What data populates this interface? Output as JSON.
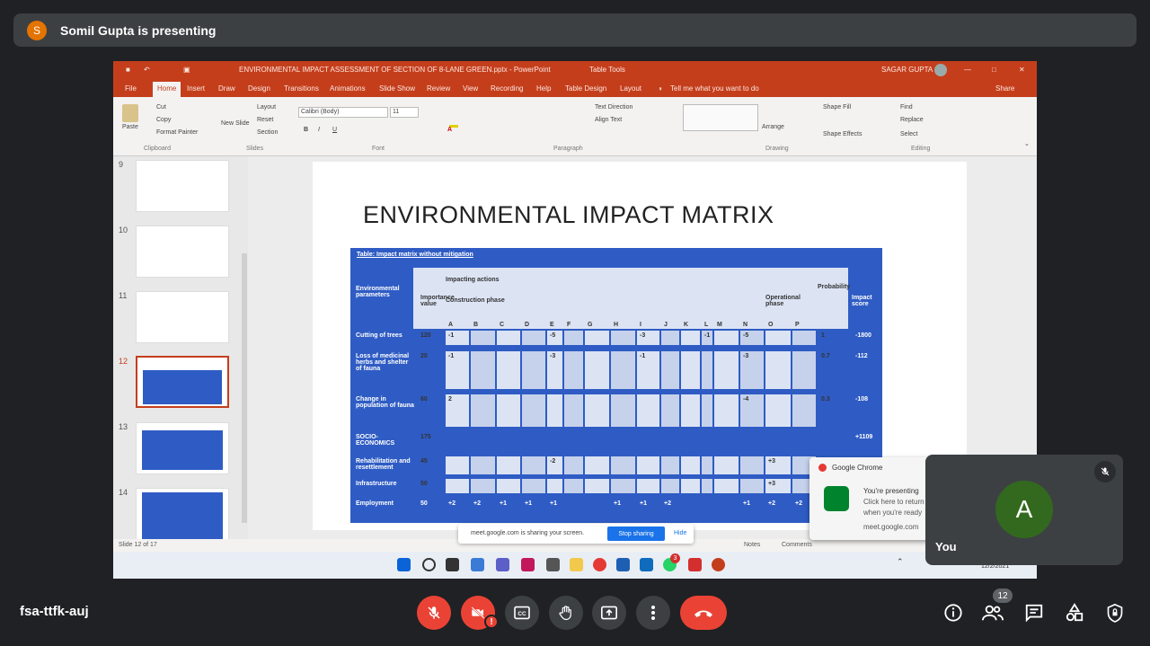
{
  "meet": {
    "presenter_initial": "S",
    "presenting_text": "Somil Gupta is presenting",
    "meeting_code": "fsa-ttfk-auj",
    "participant_count": "12",
    "self_initial": "A",
    "self_label": "You"
  },
  "ppt": {
    "title": "ENVIRONMENTAL IMPACT ASSESSMENT OF SECTION OF 8-LANE GREEN.pptx - PowerPoint",
    "table_tools": "Table Tools",
    "user": "SAGAR GUPTA",
    "tabs": [
      "File",
      "Home",
      "Insert",
      "Draw",
      "Design",
      "Transitions",
      "Animations",
      "Slide Show",
      "Review",
      "View",
      "Recording",
      "Help",
      "Table Design",
      "Layout"
    ],
    "tell_me": "Tell me what you want to do",
    "share": "Share",
    "ribbon": {
      "paste": "Paste",
      "cut": "Cut",
      "copy": "Copy",
      "format_painter": "Format Painter",
      "new_slide": "New Slide",
      "layout": "Layout",
      "reset": "Reset",
      "section": "Section",
      "font_name": "Calibri (Body)",
      "font_size": "11",
      "text_direction": "Text Direction",
      "align_text": "Align Text",
      "arrange": "Arrange",
      "shape_fill": "Shape Fill",
      "shape_effects": "Shape Effects",
      "find": "Find",
      "replace": "Replace",
      "select": "Select",
      "groups": [
        "Clipboard",
        "Slides",
        "Font",
        "Paragraph",
        "Drawing",
        "Editing"
      ]
    },
    "thumb_numbers": [
      "9",
      "10",
      "11",
      "12",
      "13",
      "14"
    ],
    "slide_title": "ENVIRONMENTAL IMPACT MATRIX",
    "status": "Slide 12 of 17",
    "notes": "Notes",
    "comments": "Comments",
    "clock_date": "12/2/2021",
    "taskbar_badge": "3"
  },
  "table": {
    "caption": "Table: Impact matrix without mitigation",
    "h_env": "Environmental parameters",
    "h_importance": "Importance value",
    "h_impacting": "Impacting actions",
    "h_construction": "Construction phase",
    "h_operational": "Operational phase",
    "h_prob": "Probability",
    "h_impact": "Impact score",
    "letters": [
      "A",
      "B",
      "C",
      "D",
      "E",
      "F",
      "G",
      "H",
      "I",
      "J",
      "K",
      "L",
      "M",
      "N",
      "O",
      "P"
    ],
    "rows": [
      {
        "name": "Cutting of trees",
        "imp": "120",
        "vals": [
          "-1",
          "",
          "",
          "",
          "-5",
          "",
          "",
          "",
          "-3",
          "",
          "",
          "-1",
          "",
          "-5",
          "",
          ""
        ],
        "prob": "1",
        "score": "-1800"
      },
      {
        "name": "Loss of medicinal herbs and shelter of fauna",
        "imp": "20",
        "vals": [
          "-1",
          "",
          "",
          "",
          "-3",
          "",
          "",
          "",
          "-1",
          "",
          "",
          "",
          "",
          "-3",
          "",
          ""
        ],
        "prob": "0.7",
        "score": "-112"
      },
      {
        "name": "Change in population of fauna",
        "imp": "60",
        "vals": [
          "2",
          "",
          "",
          "",
          "",
          "",
          "",
          "",
          "",
          "",
          "",
          "",
          "",
          "-4",
          "",
          ""
        ],
        "prob": "0.3",
        "score": "-108"
      },
      {
        "name": "SOCIO-ECONOMICS",
        "imp": "175",
        "vals": [],
        "prob": "",
        "score": "+1109"
      },
      {
        "name": "Rehabilitation and resettlement",
        "imp": "45",
        "vals": [
          "",
          "",
          "",
          "",
          "-2",
          "",
          "",
          "",
          "",
          "",
          "",
          "",
          "",
          "",
          "+3",
          ""
        ],
        "prob": "",
        "score": ""
      },
      {
        "name": "Infrastructure",
        "imp": "50",
        "vals": [
          "",
          "",
          "",
          "",
          "",
          "",
          "",
          "",
          "",
          "",
          "",
          "",
          "",
          "",
          "+3",
          ""
        ],
        "prob": "",
        "score": ""
      },
      {
        "name": "Employment",
        "imp": "50",
        "vals": [
          "+2",
          "+2",
          "+1",
          "+1",
          "+1",
          "",
          "",
          "+1",
          "+1",
          "+2",
          "",
          "",
          "",
          "+1",
          "+2",
          "+2"
        ],
        "prob": "",
        "score": ""
      }
    ]
  },
  "share_bar": {
    "text": "meet.google.com is sharing your screen.",
    "stop": "Stop sharing",
    "hide": "Hide"
  },
  "notification": {
    "app": "Google Chrome",
    "line1": "You're presenting",
    "line2": "Click here to return",
    "line3": "when you're ready",
    "domain": "meet.google.com"
  },
  "colors": {
    "ppt_accent": "#c43e1c",
    "table_blue": "#2f5cc4",
    "end_call": "#ea4335",
    "self_avatar": "#33691e",
    "presenter_avatar": "#e37400"
  }
}
